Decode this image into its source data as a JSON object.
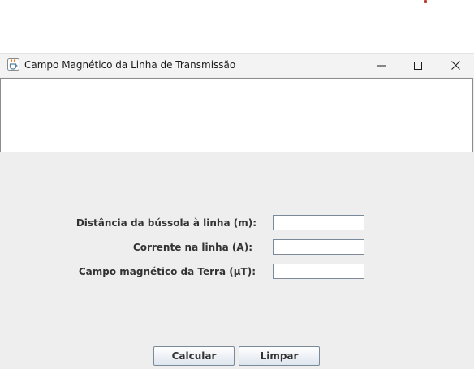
{
  "window": {
    "title": "Campo Magnético da Linha de Transmissão"
  },
  "output_area": {
    "value": ""
  },
  "form": {
    "distance_label": "Distância da bússola à linha (m):",
    "distance_value": "",
    "current_label": "Corrente na linha (A):",
    "current_value": "",
    "earth_field_label": "Campo magnético da Terra (μT):",
    "earth_field_value": ""
  },
  "buttons": {
    "calculate_label": "Calcular",
    "clear_label": "Limpar"
  }
}
